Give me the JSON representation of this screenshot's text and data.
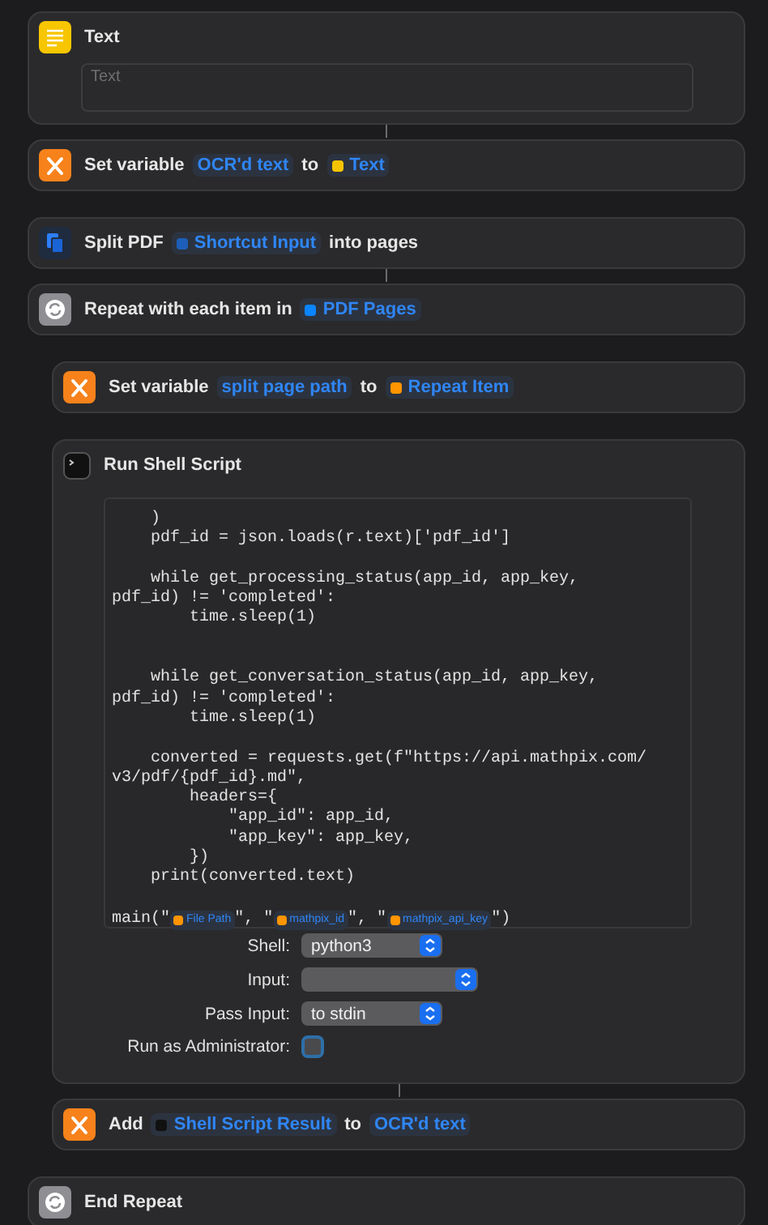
{
  "actions": [
    {
      "kind": "text",
      "linked": false,
      "parts": [
        {
          "kind": "word",
          "text": "Text"
        }
      ],
      "field": {
        "placeholder": "Text"
      }
    },
    {
      "kind": "set_variable",
      "linked": true,
      "parts": [
        {
          "kind": "word",
          "text": "Set variable"
        },
        {
          "kind": "variable",
          "text": "OCR'd text"
        },
        {
          "kind": "word",
          "text": "to"
        },
        {
          "kind": "variable",
          "text": "Text",
          "color": "#f5c400"
        }
      ]
    },
    {
      "kind": "split_pdf",
      "linked": false,
      "parts": [
        {
          "kind": "word",
          "text": "Split PDF"
        },
        {
          "kind": "variable",
          "text": "Shortcut Input",
          "color": "#1d5fb8"
        },
        {
          "kind": "word",
          "text": "into pages"
        }
      ]
    },
    {
      "kind": "repeat",
      "linked": true,
      "parts": [
        {
          "kind": "word",
          "text": "Repeat with each item in"
        },
        {
          "kind": "variable",
          "text": "PDF Pages",
          "color": "#0a84ff"
        }
      ],
      "children": [
        {
          "kind": "set_variable",
          "linked": false,
          "parts": [
            {
              "kind": "word",
              "text": "Set variable"
            },
            {
              "kind": "variable",
              "text": "split page path"
            },
            {
              "kind": "word",
              "text": "to"
            },
            {
              "kind": "variable",
              "text": "Repeat Item",
              "color": "#ff9500"
            }
          ]
        },
        {
          "kind": "shell",
          "linked": false,
          "parts": [
            {
              "kind": "word",
              "text": "Run Shell Script"
            }
          ],
          "code": "    )\n    pdf_id = json.loads(r.text)['pdf_id']\n\n    while get_processing_status(app_id, app_key,\npdf_id) != 'completed':\n        time.sleep(1)\n\n\n    while get_conversation_status(app_id, app_key,\npdf_id) != 'completed':\n        time.sleep(1)\n\n    converted = requests.get(f\"https://api.mathpix.com/\nv3/pdf/{pdf_id}.md\",\n        headers={\n            \"app_id\": app_id,\n            \"app_key\": app_key,\n        })\n    print(converted.text)",
          "call": [
            {
              "kind": "code",
              "text": "main(\""
            },
            {
              "kind": "variable",
              "text": "File Path",
              "color": "#ff9500"
            },
            {
              "kind": "code",
              "text": "\", \""
            },
            {
              "kind": "variable",
              "text": "mathpix_id",
              "color": "#ff9500"
            },
            {
              "kind": "code",
              "text": "\", \""
            },
            {
              "kind": "variable",
              "text": "mathpix_api_key",
              "color": "#ff9500"
            },
            {
              "kind": "code",
              "text": "\")"
            }
          ],
          "options": [
            {
              "kind": "popup",
              "label": "Shell:",
              "value": "python3"
            },
            {
              "kind": "popup",
              "label": "Input:"
            },
            {
              "kind": "popup",
              "label": "Pass Input:",
              "value": "to stdin"
            },
            {
              "kind": "checkbox",
              "label": "Run as Administrator:",
              "checked": false
            }
          ]
        },
        {
          "kind": "add",
          "linked": true,
          "parts": [
            {
              "kind": "word",
              "text": "Add"
            },
            {
              "kind": "variable",
              "text": "Shell Script Result",
              "color": "#111111"
            },
            {
              "kind": "word",
              "text": "to"
            },
            {
              "kind": "variable",
              "text": "OCR'd text"
            }
          ]
        }
      ]
    },
    {
      "kind": "end_repeat",
      "linked": false,
      "parts": [
        {
          "kind": "word",
          "text": "End Repeat"
        }
      ]
    }
  ]
}
